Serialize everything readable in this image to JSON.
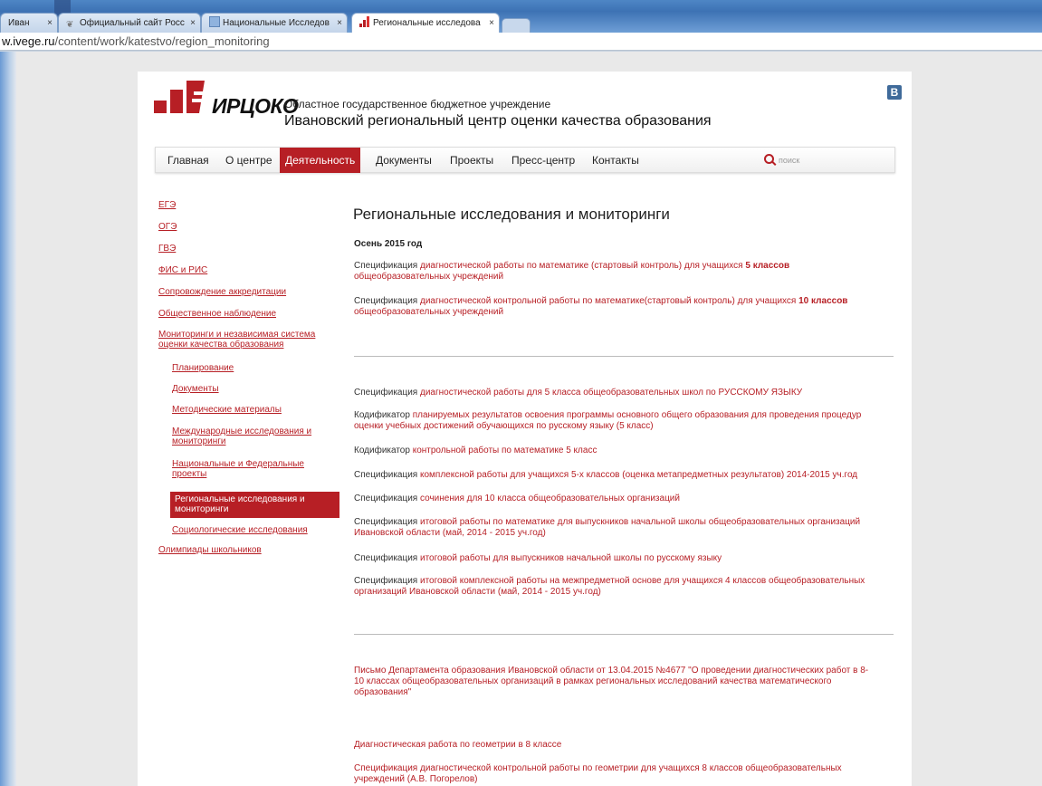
{
  "browser": {
    "tabs": [
      {
        "label": "Иван"
      },
      {
        "label": "Официальный сайт Росс"
      },
      {
        "label": "Национальные Исследов"
      },
      {
        "label": "Региональные исследова"
      }
    ],
    "url_prefix": "w.ivege.ru",
    "url_path": "/content/work/katestvo/region_monitoring"
  },
  "header": {
    "logo_text": "ИРЦОКО",
    "org_line1": "Областное государственное бюджетное учреждение",
    "org_line2": "Ивановский региональный центр оценки качества образования",
    "vk_label": "В"
  },
  "nav": {
    "items": [
      "Главная",
      "О центре",
      "Деятельность",
      "Документы",
      "Проекты",
      "Пресс-центр",
      "Контакты"
    ],
    "active_index": 2,
    "search_placeholder": "поиск"
  },
  "sidebar": {
    "items": [
      "ЕГЭ",
      "ОГЭ",
      "ГВЭ",
      "ФИС и РИС",
      "Сопровождение аккредитации",
      "Общественное наблюдение"
    ],
    "monitoring_line1": "Мониторинги и независимая система",
    "monitoring_line2": "оценки качества образования",
    "sub_items": [
      {
        "l1": "Планирование",
        "l2": ""
      },
      {
        "l1": "Документы",
        "l2": ""
      },
      {
        "l1": "Методические материалы",
        "l2": ""
      },
      {
        "l1": "Международные исследования и",
        "l2": "мониторинги"
      },
      {
        "l1": "Национальные и Федеральные",
        "l2": "проекты"
      }
    ],
    "active_l1": "Региональные исследования и",
    "active_l2": "мониторинги",
    "after_active": "Социологические исследования",
    "olympiads": "Олимпиады школьников"
  },
  "main": {
    "title": "Региональные исследования и мониторинги",
    "season": "Осень 2015 год",
    "autumn": [
      {
        "label": "Спецификация",
        "link": "диагностической работы по математике (стартовый контроль) для учащихся",
        "bold": "5 классов",
        "line2": "общеобразовательных учреждений"
      },
      {
        "label": "Спецификация",
        "link": "диагностической контрольной работы по математике(стартовый контроль) для учащихся",
        "bold": "10 классов",
        "line2": "общеобразовательных учреждений"
      }
    ],
    "specs": [
      {
        "label": "Спецификация",
        "link": "диагностической работы для 5 класса общеобразовательных школ по РУССКОМУ ЯЗЫКУ",
        "line2": ""
      },
      {
        "label": "Кодификатор",
        "link": "планируемых результатов освоения программы основного общего образования для проведения процедур",
        "line2": "оценки учебных достижений обучающихся по русскому языку (5 класс)"
      },
      {
        "label": "Кодификатор",
        "link": "контрольной работы по математике 5 класс",
        "line2": ""
      },
      {
        "label": "Спецификация",
        "link": "комплексной работы для учащихся 5-х классов (оценка метапредметных результатов) 2014-2015 уч.год",
        "line2": ""
      },
      {
        "label": "Спецификация",
        "link": "сочинения для 10 класса общеобразовательных организаций",
        "line2": ""
      },
      {
        "label": "Спецификация",
        "link": "итоговой работы по математике для выпускников начальной школы общеобразовательных организаций",
        "line2": "Ивановской области (май, 2014 - 2015 уч.год)"
      },
      {
        "label": "Спецификация",
        "link": "итоговой работы для выпускников начальной школы по русскому языку",
        "line2": ""
      },
      {
        "label": "Спецификация",
        "link": "итоговой комплексной работы на межпредметной основе для учащихся 4 классов общеобразовательных",
        "line2": "организаций Ивановской области (май, 2014 - 2015 уч.год)"
      }
    ],
    "letter_l1": "Письмо Департамента образования Ивановской области от 13.04.2015 №4677 \"О проведении диагностических работ в 8-",
    "letter_l2": "10 классах общеобразовательных организаций в рамках региональных исследований качества математического",
    "letter_l3": "образования\"",
    "geometry_title": "Диагностическая работа по геометрии в 8 классе",
    "geometry_spec_label": "Спецификация",
    "geometry_spec_link": "диагностической контрольной работы по геометрии для учащихся 8 классов общеобразовательных",
    "geometry_spec_l2": "учреждений (А.В. Погорелов)"
  },
  "colors": {
    "accent": "#b71f25"
  }
}
